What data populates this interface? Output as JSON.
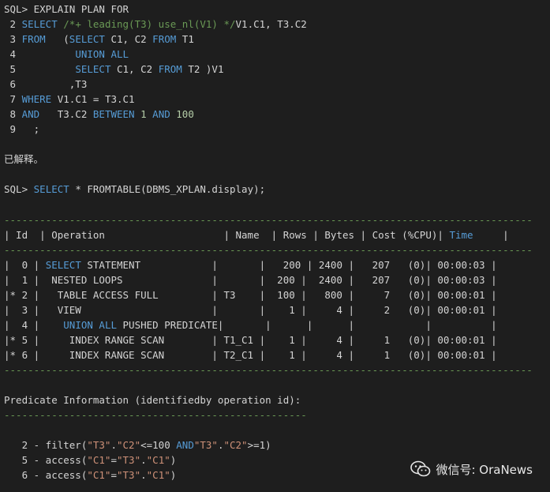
{
  "sql1": {
    "prompt": "SQL> EXPLAIN PLAN FOR",
    "lines": [
      {
        "no": " 2",
        "parts": [
          [
            "kw",
            "SELECT "
          ],
          [
            "cm",
            "/*+ leading(T3) use_nl(V1) */"
          ],
          [
            "",
            "V1.C1, T3.C2"
          ]
        ]
      },
      {
        "no": " 3",
        "parts": [
          [
            "kw",
            "FROM"
          ],
          [
            "",
            "   ("
          ],
          [
            "kw",
            "SELECT"
          ],
          [
            "",
            " C1, C2 "
          ],
          [
            "kw",
            "FROM"
          ],
          [
            "",
            " T1"
          ]
        ]
      },
      {
        "no": " 4",
        "parts": [
          [
            "",
            "         "
          ],
          [
            "kw",
            "UNION ALL"
          ]
        ]
      },
      {
        "no": " 5",
        "parts": [
          [
            "",
            "         "
          ],
          [
            "kw",
            "SELECT"
          ],
          [
            "",
            " C1, C2 "
          ],
          [
            "kw",
            "FROM"
          ],
          [
            "",
            " T2 )V1"
          ]
        ]
      },
      {
        "no": " 6",
        "parts": [
          [
            "",
            "        ,T3"
          ]
        ]
      },
      {
        "no": " 7",
        "parts": [
          [
            "kw",
            "WHERE"
          ],
          [
            "",
            " V1.C1 = T3.C1"
          ]
        ]
      },
      {
        "no": " 8",
        "parts": [
          [
            "kw",
            "AND"
          ],
          [
            "",
            "   T3.C2 "
          ],
          [
            "kw",
            "BETWEEN"
          ],
          [
            "",
            " "
          ],
          [
            "num",
            "1"
          ],
          [
            "",
            " "
          ],
          [
            "kw",
            "AND"
          ],
          [
            "",
            " "
          ],
          [
            "num",
            "100"
          ]
        ]
      },
      {
        "no": " 9",
        "parts": [
          [
            "",
            "  ;"
          ]
        ]
      }
    ]
  },
  "explained": "已解释。",
  "sql2": {
    "prefix": "SQL> ",
    "kw": "SELECT",
    "rest": " * FROMTABLE(DBMS_XPLAN.display);"
  },
  "plan": {
    "dash_line": "-----------------------------------------------------------------------------------------",
    "header_pre": "| Id  | Operation                    | Name  | Rows | Bytes | Cost (%CPU)| ",
    "header_time": "Time",
    "header_post": "     |",
    "rows": [
      [
        [
          "",
          "|  0 | "
        ],
        [
          "kw",
          "SELECT"
        ],
        [
          "",
          " STATEMENT            |       |   200 | 2400 |   207   (0)| 00:00:03 |"
        ]
      ],
      [
        [
          "",
          "|  1 |  NESTED LOOPS               |       |  200 |  2400 |   207   (0)| 00:00:03 |"
        ]
      ],
      [
        [
          "",
          "|* 2 |   TABLE ACCESS FULL         | T3    |  100 |   800 |     7   (0)| 00:00:01 |"
        ]
      ],
      [
        [
          "",
          "|  3 |   VIEW                      |       |    1 |     4 |     2   (0)| 00:00:01 |"
        ]
      ],
      [
        [
          "",
          "|  4 |    "
        ],
        [
          "kw",
          "UNION ALL"
        ],
        [
          "",
          " PUSHED PREDICATE|       |      |      |            |          |"
        ]
      ],
      [
        [
          "",
          "|* 5 |     INDEX RANGE SCAN        | T1_C1 |    1 |     4 |     1   (0)| 00:00:01 |"
        ]
      ],
      [
        [
          "",
          "|* 6 |     INDEX RANGE SCAN        | T2_C1 |    1 |     4 |     1   (0)| 00:00:01 |"
        ]
      ]
    ]
  },
  "predicate": {
    "title": "Predicate Information (identifiedby operation id):",
    "dash_line": "---------------------------------------------------",
    "lines": [
      [
        [
          "",
          "   2 - filter("
        ],
        [
          "str",
          "\"T3\""
        ],
        [
          "",
          "."
        ],
        [
          "str",
          "\"C2\""
        ],
        [
          "",
          "<=100 "
        ],
        [
          "kw",
          "AND"
        ],
        [
          "str",
          "\"T3\""
        ],
        [
          "",
          "."
        ],
        [
          "str",
          "\"C2\""
        ],
        [
          "",
          ">=1)"
        ]
      ],
      [
        [
          "",
          "   5 - access("
        ],
        [
          "str",
          "\"C1\""
        ],
        [
          "",
          "="
        ],
        [
          "str",
          "\"T3\""
        ],
        [
          "",
          "."
        ],
        [
          "str",
          "\"C1\""
        ],
        [
          "",
          ")"
        ]
      ],
      [
        [
          "",
          "   6 - access("
        ],
        [
          "str",
          "\"C1\""
        ],
        [
          "",
          "="
        ],
        [
          "str",
          "\"T3\""
        ],
        [
          "",
          "."
        ],
        [
          "str",
          "\"C1\""
        ],
        [
          "",
          ")"
        ]
      ]
    ]
  },
  "watermark": {
    "text": "微信号: OraNews",
    "icon": "wechat-icon"
  }
}
